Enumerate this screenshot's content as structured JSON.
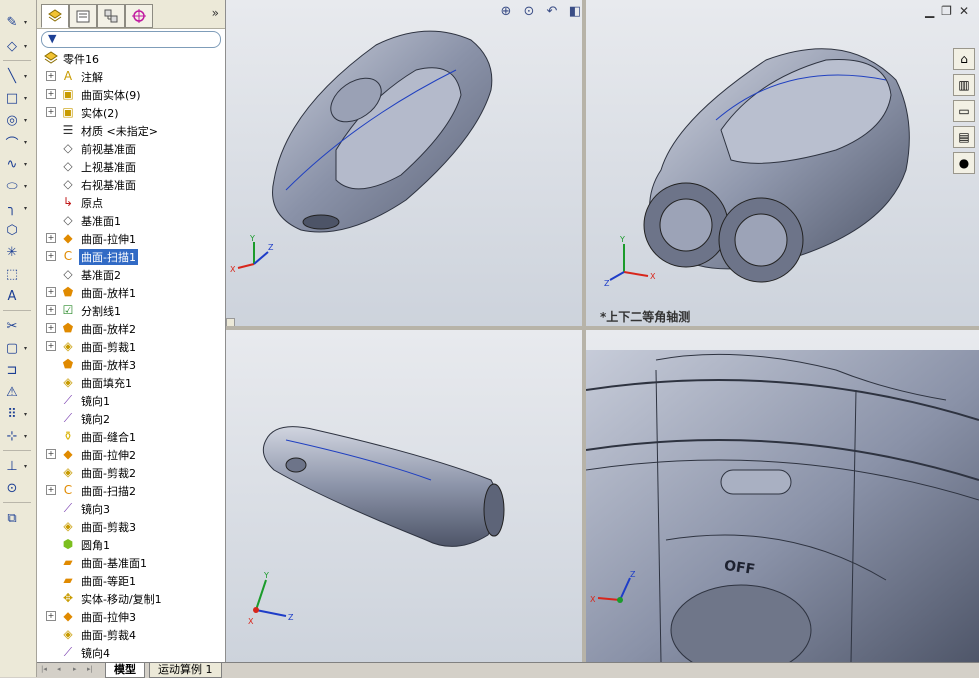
{
  "feature_tree": {
    "root": "零件16",
    "items": [
      {
        "label": "注解",
        "expand": "+",
        "icon": "A"
      },
      {
        "label": "曲面实体(9)",
        "expand": "+",
        "icon": "▣"
      },
      {
        "label": "实体(2)",
        "expand": "+",
        "icon": "▣"
      },
      {
        "label": "材质 <未指定>",
        "expand": "",
        "icon": "☰"
      },
      {
        "label": "前视基准面",
        "expand": "",
        "icon": "◇"
      },
      {
        "label": "上视基准面",
        "expand": "",
        "icon": "◇"
      },
      {
        "label": "右视基准面",
        "expand": "",
        "icon": "◇"
      },
      {
        "label": "原点",
        "expand": "",
        "icon": "↳"
      },
      {
        "label": "基准面1",
        "expand": "",
        "icon": "◇"
      },
      {
        "label": "曲面-拉伸1",
        "expand": "+",
        "icon": "◆"
      },
      {
        "label": "曲面-扫描1",
        "expand": "+",
        "icon": "C"
      },
      {
        "label": "基准面2",
        "expand": "",
        "icon": "◇"
      },
      {
        "label": "曲面-放样1",
        "expand": "+",
        "icon": "⬟"
      },
      {
        "label": "分割线1",
        "expand": "+",
        "icon": "☑"
      },
      {
        "label": "曲面-放样2",
        "expand": "+",
        "icon": "⬟"
      },
      {
        "label": "曲面-剪裁1",
        "expand": "+",
        "icon": "◈"
      },
      {
        "label": "曲面-放样3",
        "expand": "",
        "icon": "⬟"
      },
      {
        "label": "曲面填充1",
        "expand": "",
        "icon": "◈"
      },
      {
        "label": "镜向1",
        "expand": "",
        "icon": "⟋"
      },
      {
        "label": "镜向2",
        "expand": "",
        "icon": "⟋"
      },
      {
        "label": "曲面-缝合1",
        "expand": "",
        "icon": "⚱"
      },
      {
        "label": "曲面-拉伸2",
        "expand": "+",
        "icon": "◆"
      },
      {
        "label": "曲面-剪裁2",
        "expand": "",
        "icon": "◈"
      },
      {
        "label": "曲面-扫描2",
        "expand": "+",
        "icon": "C"
      },
      {
        "label": "镜向3",
        "expand": "",
        "icon": "⟋"
      },
      {
        "label": "曲面-剪裁3",
        "expand": "",
        "icon": "◈"
      },
      {
        "label": "圆角1",
        "expand": "",
        "icon": "⬢"
      },
      {
        "label": "曲面-基准面1",
        "expand": "",
        "icon": "▰"
      },
      {
        "label": "曲面-等距1",
        "expand": "",
        "icon": "▰"
      },
      {
        "label": "实体-移动/复制1",
        "expand": "",
        "icon": "✥"
      },
      {
        "label": "曲面-拉伸3",
        "expand": "+",
        "icon": "◆"
      },
      {
        "label": "曲面-剪裁4",
        "expand": "",
        "icon": "◈"
      },
      {
        "label": "镜向4",
        "expand": "",
        "icon": "⟋"
      }
    ],
    "selected_index": 10
  },
  "bottom_tabs": [
    "模型",
    "运动算例 1"
  ],
  "view_caption": "*上下二等角轴测",
  "viewport_text": "OFF",
  "triad": {
    "x": "X",
    "y": "Y",
    "z": "Z"
  },
  "colors": {
    "accent": "#316ac5",
    "triad_x": "#d8261b",
    "triad_y": "#1b9b2b",
    "triad_z": "#1e3dc8",
    "model": "#8a92a8"
  }
}
